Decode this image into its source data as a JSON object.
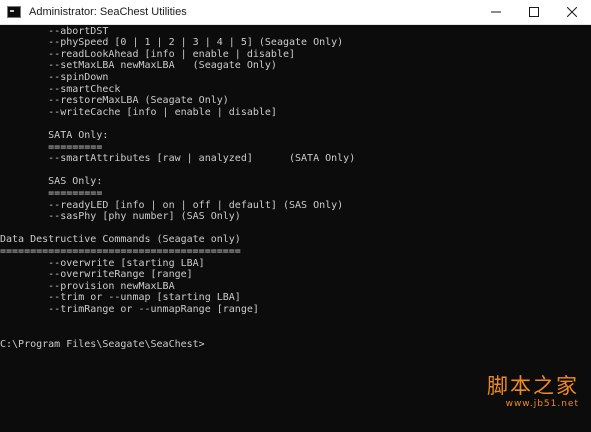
{
  "window": {
    "title": "Administrator: SeaChest Utilities",
    "icon": "terminal-icon",
    "controls": [
      "minimize-icon",
      "maximize-icon",
      "close-icon"
    ]
  },
  "console": {
    "lines": [
      "        --abortDST",
      "        --phySpeed [0 | 1 | 2 | 3 | 4 | 5] (Seagate Only)",
      "        --readLookAhead [info | enable | disable]",
      "        --setMaxLBA newMaxLBA   (Seagate Only)",
      "        --spinDown",
      "        --smartCheck",
      "        --restoreMaxLBA (Seagate Only)",
      "        --writeCache [info | enable | disable]",
      "",
      "        SATA Only:",
      "        =========",
      "        --smartAttributes [raw | analyzed]      (SATA Only)",
      "",
      "        SAS Only:",
      "        =========",
      "        --readyLED [info | on | off | default] (SAS Only)",
      "        --sasPhy [phy number] (SAS Only)",
      "",
      "Data Destructive Commands (Seagate only)",
      "========================================",
      "        --overwrite [starting LBA]",
      "        --overwriteRange [range]",
      "        --provision newMaxLBA",
      "        --trim or --unmap [starting LBA]",
      "        --trimRange or --unmapRange [range]",
      "",
      "",
      "C:\\Program Files\\Seagate\\SeaChest>"
    ]
  },
  "watermark": {
    "text": "脚本之家",
    "url": "www.jb51.net",
    "color": "#f28b1e"
  },
  "colors": {
    "console_bg": "#0c0c0c",
    "console_fg": "#cccccc",
    "titlebar_bg": "#ffffff"
  }
}
